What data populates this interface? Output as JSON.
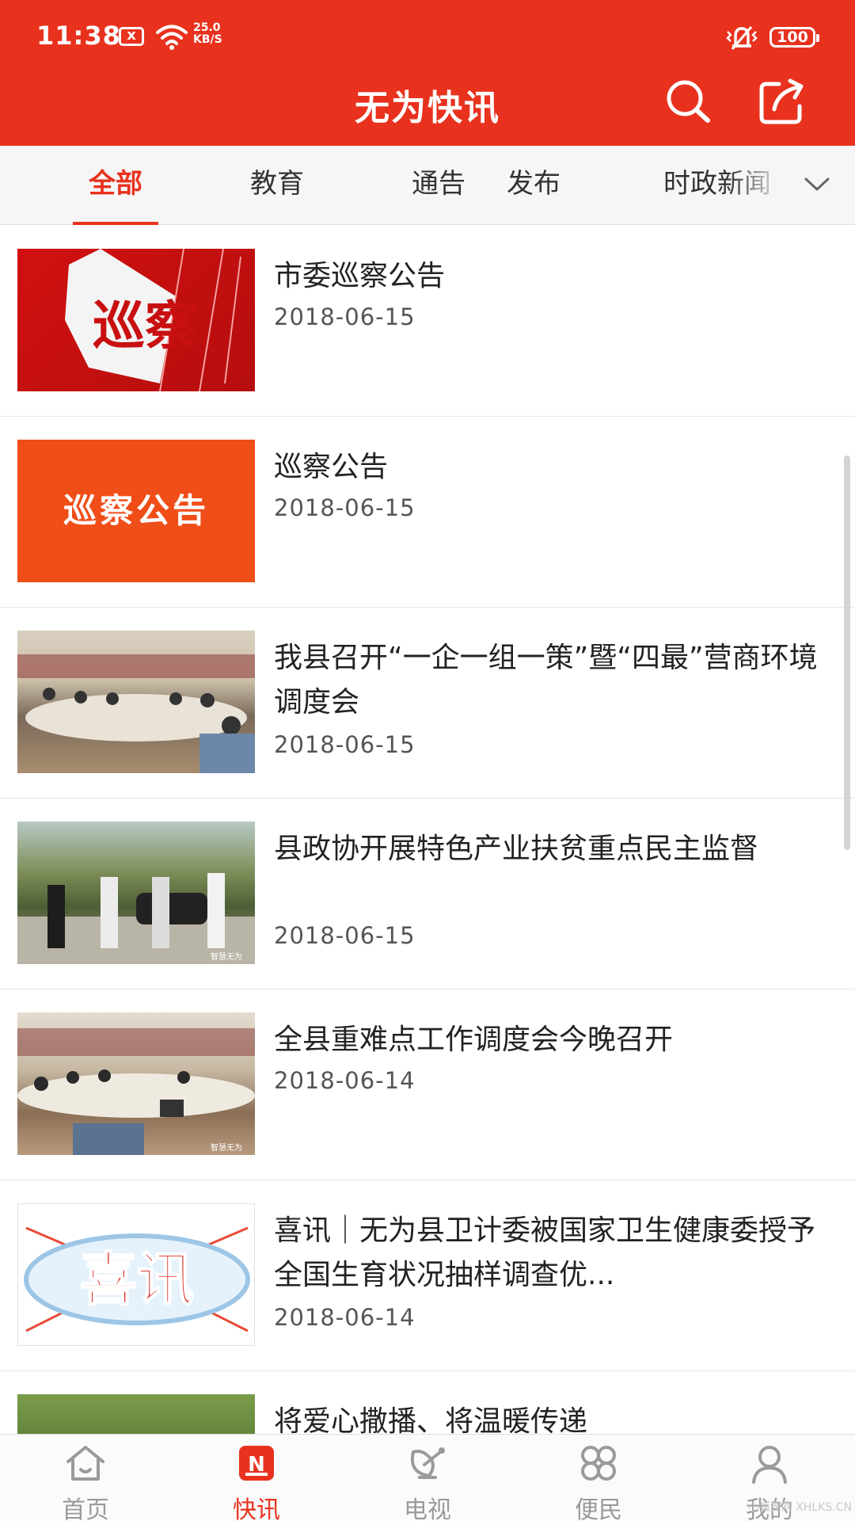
{
  "status_bar": {
    "time": "11:38",
    "close_badge": "x",
    "net_speed_value": "25.0",
    "net_speed_unit": "KB/S",
    "battery": "100"
  },
  "header": {
    "title": "无为快讯",
    "search_icon": "search-icon",
    "share_icon": "share-icon",
    "bg_color": "#e8321e"
  },
  "tabs": [
    {
      "label": "全部",
      "active": true
    },
    {
      "label": "教育",
      "active": false
    },
    {
      "label": "通告",
      "active": false
    },
    {
      "label": "发布",
      "active": false
    },
    {
      "label": "时政新闻",
      "active": false
    }
  ],
  "tabs_more_icon": "chevron-down-icon",
  "news": [
    {
      "title": "市委巡察公告",
      "date": "2018-06-15",
      "thumb": "巡察"
    },
    {
      "title": "巡察公告",
      "date": "2018-06-15",
      "thumb": "巡察公告"
    },
    {
      "title": "我县召开“一企一组一策”暨“四最”营商环境调度会",
      "date": "2018-06-15",
      "thumb": ""
    },
    {
      "title": "县政协开展特色产业扶贫重点民主监督",
      "date": "2018-06-15",
      "thumb": "智慧无为"
    },
    {
      "title": "全县重难点工作调度会今晚召开",
      "date": "2018-06-14",
      "thumb": "智慧无为"
    },
    {
      "title": "喜讯｜无为县卫计委被国家卫生健康委授予全国生育状况抽样调查优...",
      "date": "2018-06-14",
      "thumb": "喜讯"
    },
    {
      "title": "将爱心撒播、将温暖传递",
      "date": "",
      "thumb": ""
    }
  ],
  "bottom_nav": [
    {
      "label": "首页",
      "icon": "home-icon",
      "active": false
    },
    {
      "label": "快讯",
      "icon": "news-icon",
      "active": true
    },
    {
      "label": "电视",
      "icon": "tv-icon",
      "active": false
    },
    {
      "label": "便民",
      "icon": "services-icon",
      "active": false
    },
    {
      "label": "我的",
      "icon": "profile-icon",
      "active": false
    }
  ],
  "watermark": "小狐狸网 XHLKS.CN",
  "accent_color": "#e8321e"
}
